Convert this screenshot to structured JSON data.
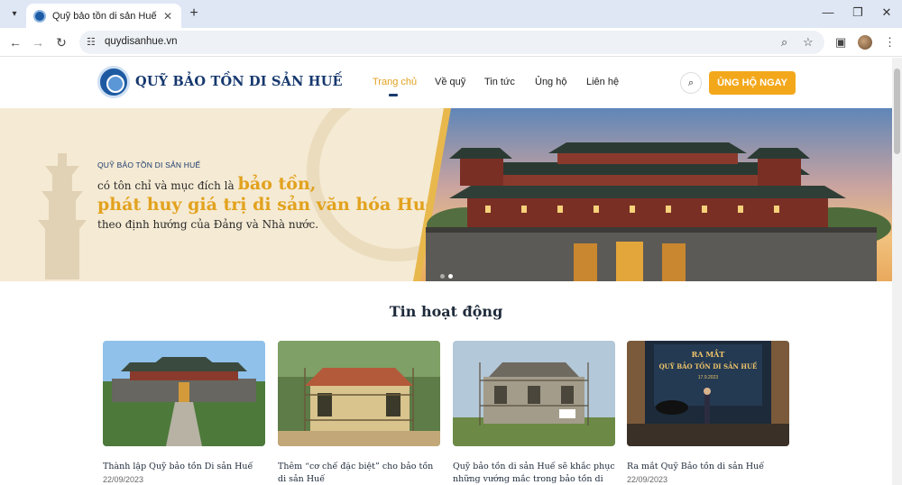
{
  "browser": {
    "tab_title": "Quỹ bảo tồn di sản Huế",
    "url": "quydisanhue.vn",
    "icons": [
      "tab-search-icon",
      "site-favicon-icon",
      "close-icon",
      "plus-icon",
      "minimize-icon",
      "restore-icon",
      "close-window-icon",
      "back-icon",
      "forward-icon",
      "reload-icon",
      "site-info-icon",
      "zoom-icon",
      "star-icon",
      "side-panel-icon",
      "profile-avatar",
      "more-icon"
    ]
  },
  "site": {
    "logo_text": "QUỸ BẢO TỒN DI SẢN HUẾ",
    "nav": [
      "Trang chủ",
      "Về quỹ",
      "Tin tức",
      "Ủng hộ",
      "Liên hệ"
    ],
    "active_nav": "Trang chủ",
    "donate_label": "ỦNG HỘ NGAY",
    "brand_color": "#f3a81c",
    "navy_color": "#16386e"
  },
  "hero": {
    "subtitle": "QUỸ BẢO TỒN DI SẢN HUẾ",
    "line1_small": "có tôn chỉ và mục đích là",
    "line1_big": "bảo tồn,",
    "line2": "phát huy giá trị di sản văn hóa Huế",
    "line3": "theo định hướng của Đảng và Nhà nước.",
    "slide_count": 2,
    "active_slide": 2
  },
  "news": {
    "title": "Tin hoạt động",
    "items": [
      {
        "title": "Thành lập Quỹ bảo tồn Di sản Huế",
        "date": "22/09/2023"
      },
      {
        "title": "Thêm “cơ chế đặc biệt” cho bảo tồn di sản Huế",
        "date": ""
      },
      {
        "title": "Quỹ bảo tồn di sản Huế sẽ khắc phục những vướng mắc trong bảo tồn di sản",
        "date": ""
      },
      {
        "title": "Ra mắt Quỹ Bảo tồn di sản Huế",
        "date": "22/09/2023"
      }
    ],
    "event_banner_line1": "RA MẮT",
    "event_banner_line2": "QUỸ BẢO TỒN DI SẢN HUẾ",
    "event_banner_date": "17.9.2023"
  }
}
